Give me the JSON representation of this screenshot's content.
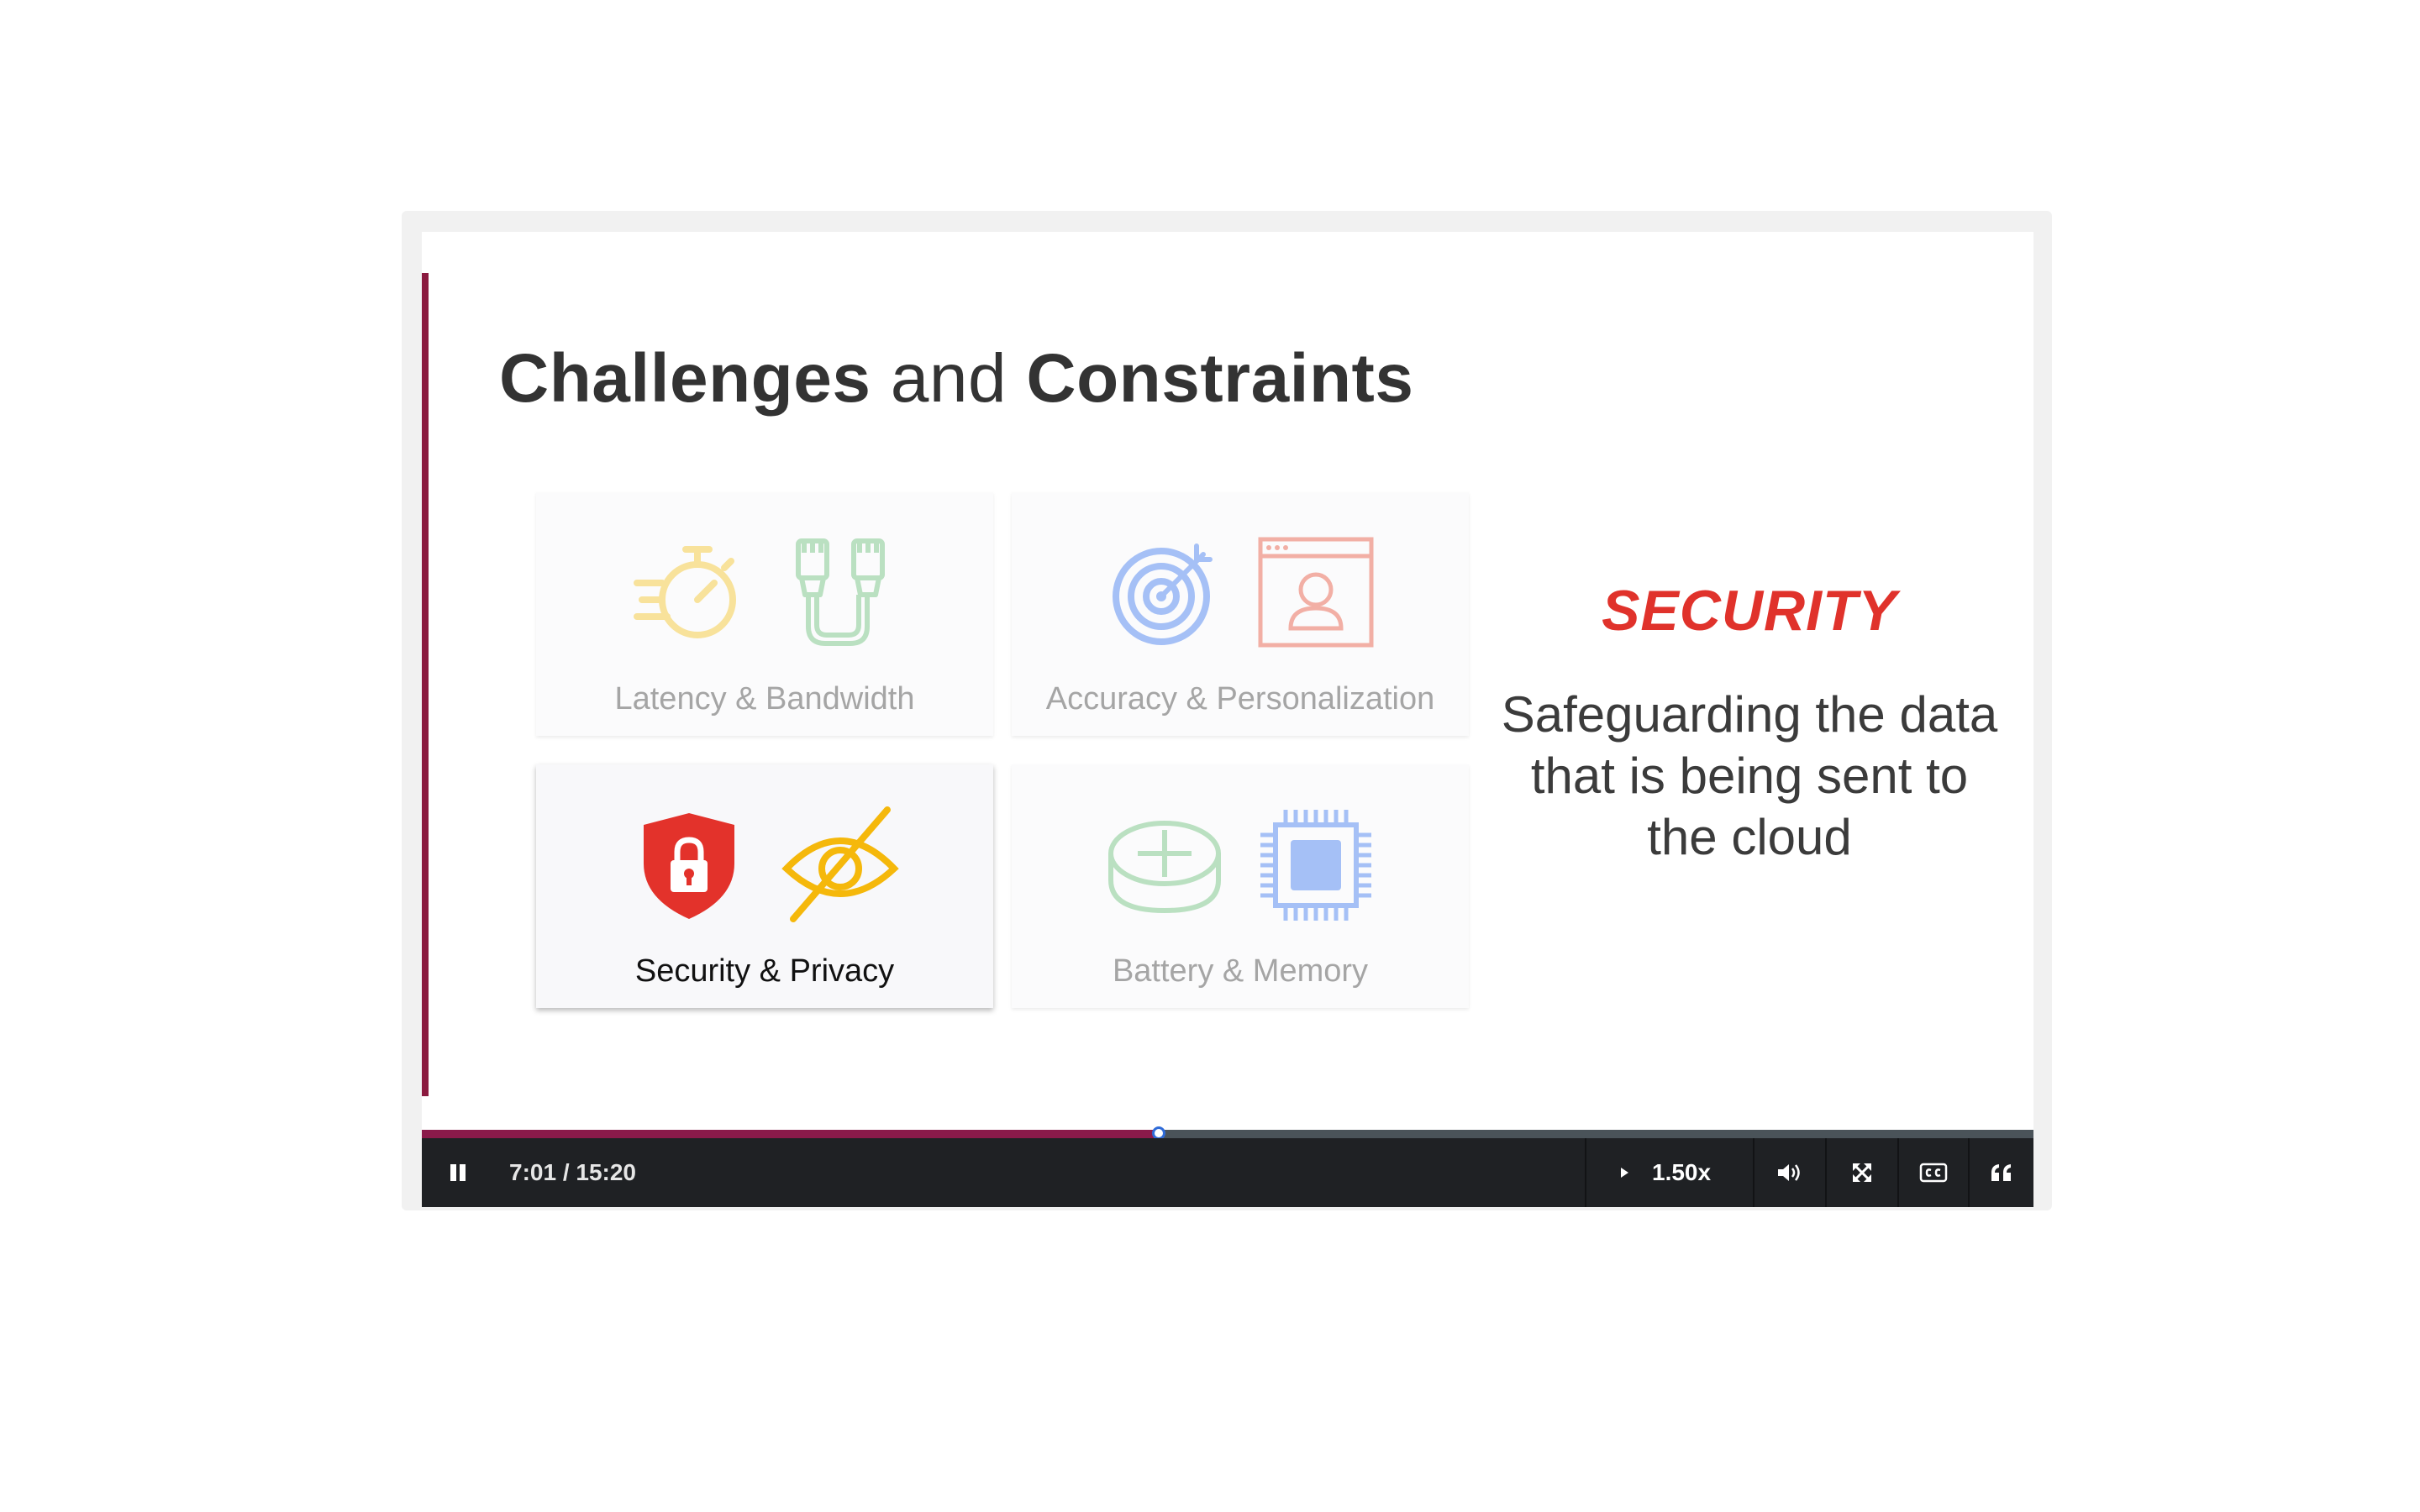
{
  "slide": {
    "title_part1": "Challenges",
    "title_connector": " and ",
    "title_part2": "Constraints",
    "cards": [
      {
        "label": "Latency & Bandwidth",
        "icons": [
          "stopwatch-icon",
          "ethernet-cable-icon"
        ],
        "active": false
      },
      {
        "label": "Accuracy & Personalization",
        "icons": [
          "target-icon",
          "user-profile-window-icon"
        ],
        "active": false
      },
      {
        "label": "Security & Privacy",
        "icons": [
          "lock-shield-icon",
          "eye-off-icon"
        ],
        "active": true
      },
      {
        "label": "Battery & Memory",
        "icons": [
          "battery-disk-icon",
          "chip-icon"
        ],
        "active": false
      }
    ],
    "side_heading": "SECURITY",
    "side_text": "Safeguarding the data that is being sent to the cloud"
  },
  "player": {
    "current_time": "7:01",
    "duration": "15:20",
    "time_display": "7:01 / 15:20",
    "progress_fraction": 0.457,
    "speed": "1.50x",
    "icons": [
      "pause-icon",
      "speed-play-icon",
      "volume-icon",
      "fullscreen-icon",
      "captions-icon",
      "transcript-quote-icon"
    ]
  },
  "colors": {
    "accent": "#8b1a3f",
    "security_red": "#e0322b",
    "progress_fill": "#8b1a4a",
    "control_bar": "#1f2124"
  }
}
